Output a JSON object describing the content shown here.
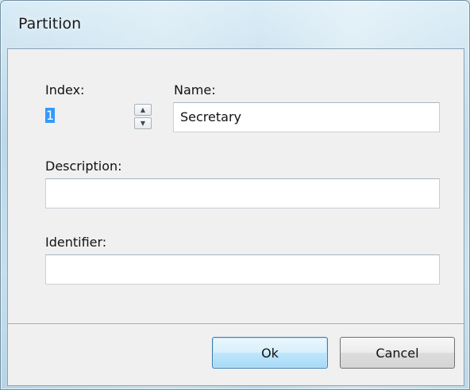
{
  "window": {
    "title": "Partition"
  },
  "form": {
    "index_label": "Index:",
    "index_value": "1",
    "name_label": "Name:",
    "name_value": "Secretary",
    "description_label": "Description:",
    "description_value": "",
    "identifier_label": "Identifier:",
    "identifier_value": ""
  },
  "buttons": {
    "ok_label": "Ok",
    "cancel_label": "Cancel"
  },
  "icons": {
    "spin_up": "spin-up-arrow-icon",
    "spin_down": "spin-down-arrow-icon"
  },
  "colors": {
    "selection": "#3399ff",
    "default_button_border": "#3c7fb1"
  }
}
